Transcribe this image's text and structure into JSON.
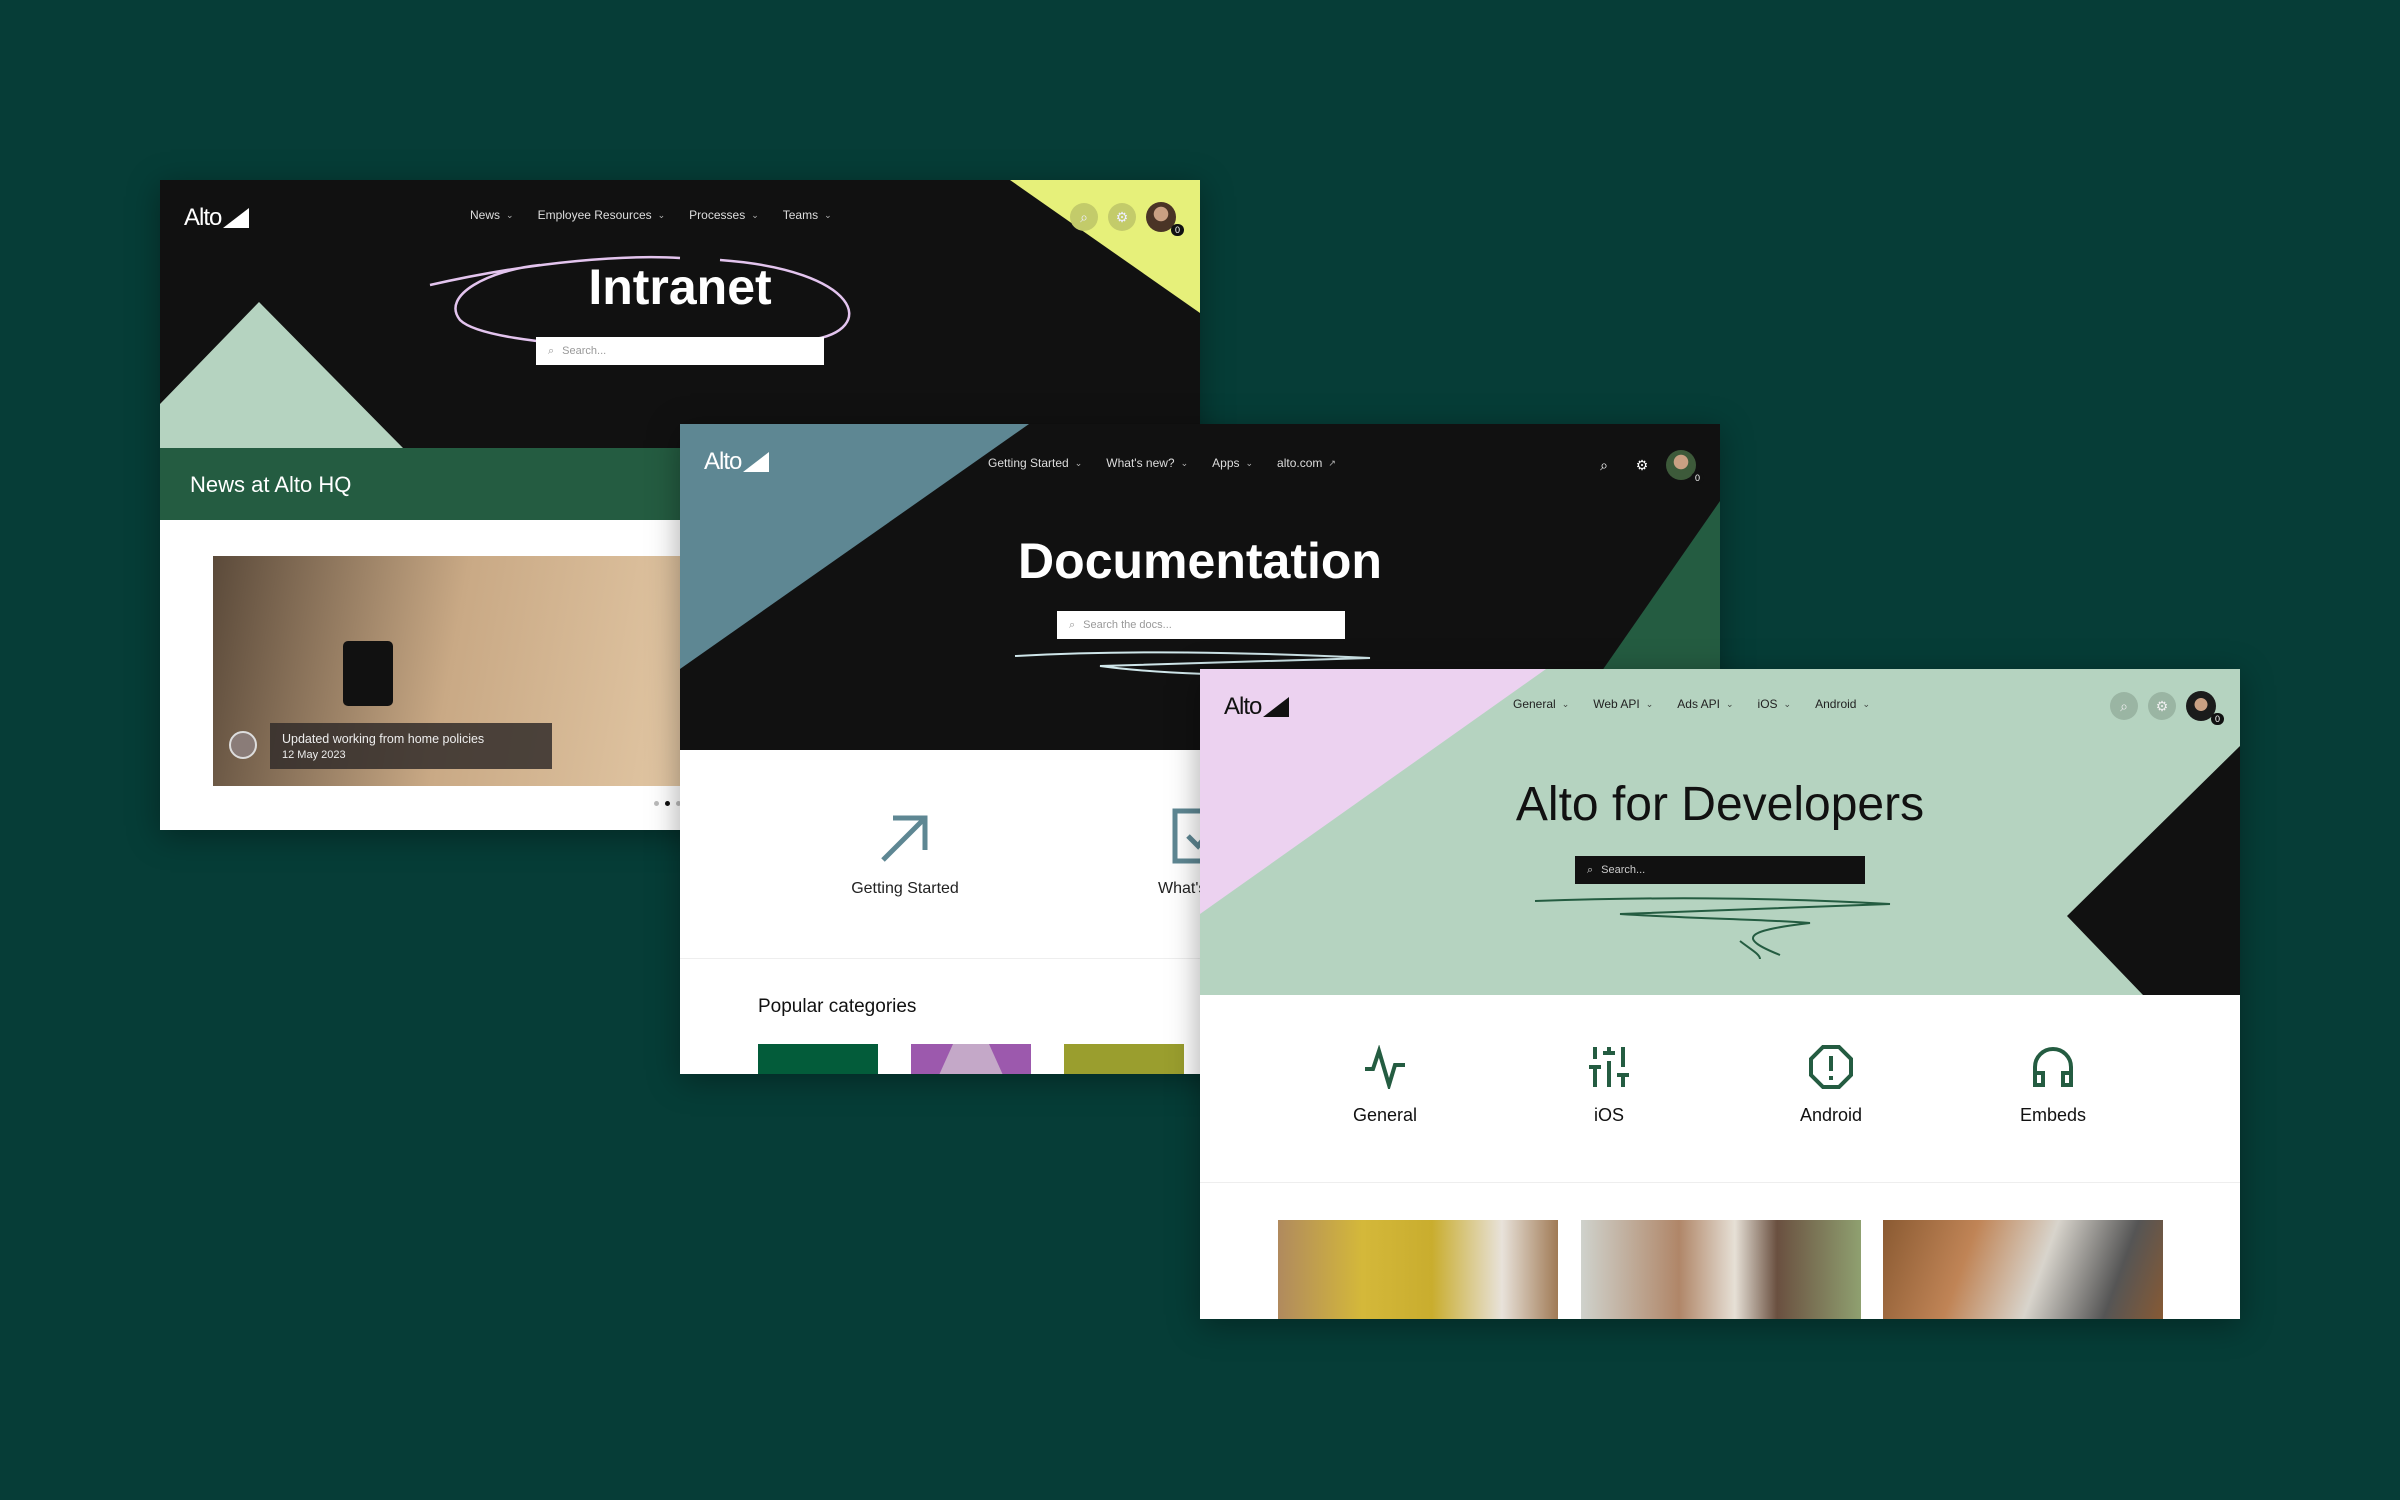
{
  "intranet": {
    "logo": "Alto",
    "nav": [
      "News",
      "Employee Resources",
      "Processes",
      "Teams"
    ],
    "title": "Intranet",
    "search_placeholder": "Search...",
    "notification_count": "0",
    "section_title": "News at Alto HQ",
    "news_item": {
      "title": "Updated working from home policies",
      "date": "12 May 2023"
    },
    "carousel": {
      "total": 3,
      "active": 2
    },
    "colors": {
      "accent_yellow": "#e6f07a",
      "accent_mint": "#b5d3c0",
      "section_green": "#245c41"
    }
  },
  "docs": {
    "logo": "Alto",
    "nav": [
      "Getting Started",
      "What's new?",
      "Apps",
      "alto.com"
    ],
    "title": "Documentation",
    "search_placeholder": "Search the docs...",
    "notification_count": "0",
    "features": [
      {
        "label": "Getting Started",
        "icon": "arrow-up-right-icon"
      },
      {
        "label": "What's",
        "icon": "checkbox-icon"
      }
    ],
    "popular_title": "Popular categories",
    "colors": {
      "accent_blue": "#5e8793",
      "accent_green": "#245c41"
    }
  },
  "dev": {
    "logo": "Alto",
    "nav": [
      "General",
      "Web API",
      "Ads API",
      "iOS",
      "Android"
    ],
    "title": "Alto for Developers",
    "search_placeholder": "Search...",
    "notification_count": "0",
    "features": [
      {
        "label": "General",
        "icon": "activity-icon"
      },
      {
        "label": "iOS",
        "icon": "sliders-icon"
      },
      {
        "label": "Android",
        "icon": "alert-octagon-icon"
      },
      {
        "label": "Embeds",
        "icon": "headphones-icon"
      }
    ],
    "colors": {
      "bg_mint": "#b5d3c0",
      "accent_pink": "#ecd2f0",
      "icon_green": "#245c41"
    }
  }
}
